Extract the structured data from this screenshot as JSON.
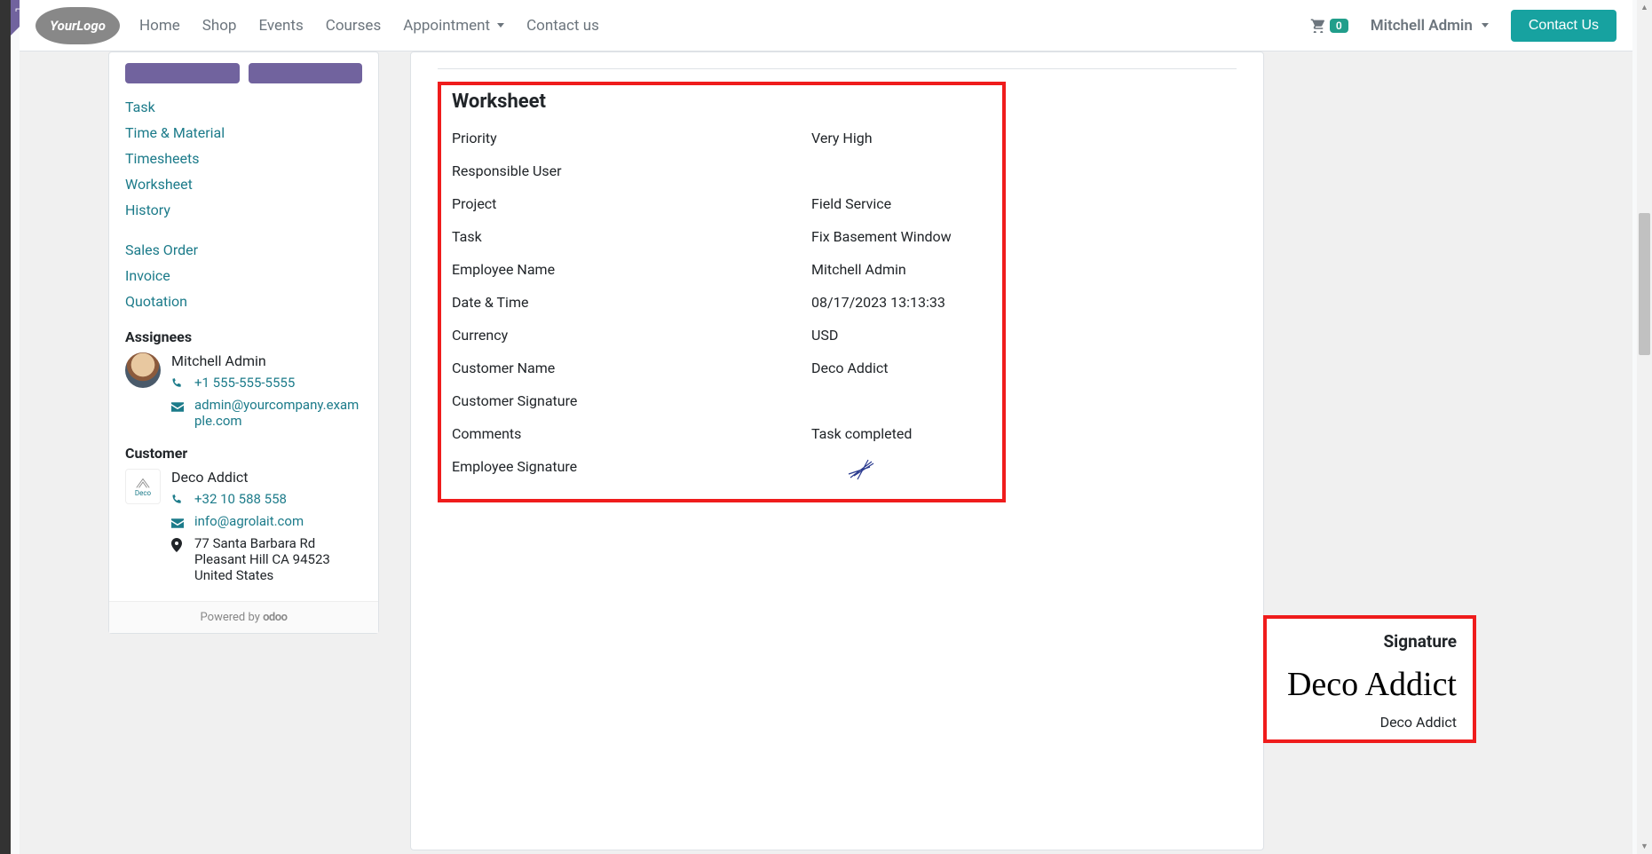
{
  "nav": {
    "logo_text": "YourLogo",
    "items": [
      "Home",
      "Shop",
      "Events",
      "Courses",
      "Appointment",
      "Contact us"
    ],
    "cart_count": "0",
    "user": "Mitchell Admin",
    "contact_btn": "Contact Us"
  },
  "sidebar": {
    "links_main": [
      "Task",
      "Time & Material",
      "Timesheets",
      "Worksheet",
      "History"
    ],
    "links_secondary": [
      "Sales Order",
      "Invoice",
      "Quotation"
    ],
    "assignees_h": "Assignees",
    "assignee": {
      "name": "Mitchell Admin",
      "phone": "+1 555-555-5555",
      "email": "admin@yourcompany.example.com"
    },
    "customer_h": "Customer",
    "customer": {
      "name": "Deco Addict",
      "logo_text": "Deco",
      "phone": "+32 10 588 558",
      "email": "info@agrolait.com",
      "address_line1": "77 Santa Barbara Rd",
      "address_line2": "Pleasant Hill CA 94523",
      "address_line3": "United States"
    },
    "powered": "Powered by ",
    "powered_brand": "odoo"
  },
  "worksheet": {
    "title": "Worksheet",
    "fields": [
      {
        "label": "Priority",
        "value": "Very High"
      },
      {
        "label": "Responsible User",
        "value": ""
      },
      {
        "label": "Project",
        "value": "Field Service"
      },
      {
        "label": "Task",
        "value": "Fix Basement Window"
      },
      {
        "label": "Employee Name",
        "value": "Mitchell Admin"
      },
      {
        "label": "Date & Time",
        "value": "08/17/2023 13:13:33"
      },
      {
        "label": "Currency",
        "value": "USD"
      },
      {
        "label": "Customer Name",
        "value": "Deco Addict"
      },
      {
        "label": "Customer Signature",
        "value": ""
      },
      {
        "label": "Comments",
        "value": "Task completed"
      },
      {
        "label": "Employee Signature",
        "value": ""
      }
    ]
  },
  "signature": {
    "heading": "Signature",
    "script": "Deco Addict",
    "name": "Deco Addict"
  }
}
